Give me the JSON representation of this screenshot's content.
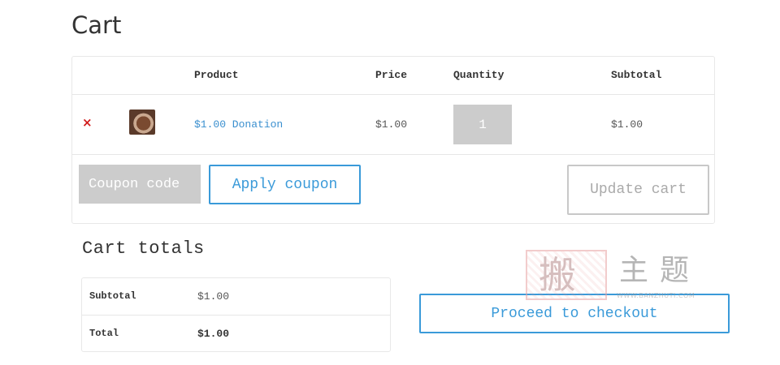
{
  "page": {
    "title": "Cart"
  },
  "cart_table": {
    "headers": {
      "product": "Product",
      "price": "Price",
      "quantity": "Quantity",
      "subtotal": "Subtotal"
    },
    "rows": [
      {
        "remove_glyph": "×",
        "thumbnail_icon": "product-thumbnail",
        "product": "$1.00 Donation",
        "price": "$1.00",
        "quantity": "1",
        "subtotal": "$1.00"
      }
    ]
  },
  "coupon": {
    "placeholder": "Coupon code",
    "apply_label": "Apply coupon"
  },
  "update_label": "Update cart",
  "totals": {
    "title": "Cart totals",
    "subtotal_label": "Subtotal",
    "subtotal_value": "$1.00",
    "total_label": "Total",
    "total_value": "$1.00"
  },
  "checkout_label": "Proceed to checkout",
  "watermark": {
    "stamp_char": "搬",
    "text": "主题",
    "url": "WWW.BANZHUTI.COM"
  },
  "colors": {
    "accent": "#3a9ad9",
    "remove": "#d11a1a",
    "input_bg": "#cccccc",
    "border": "#e8e8e8"
  }
}
